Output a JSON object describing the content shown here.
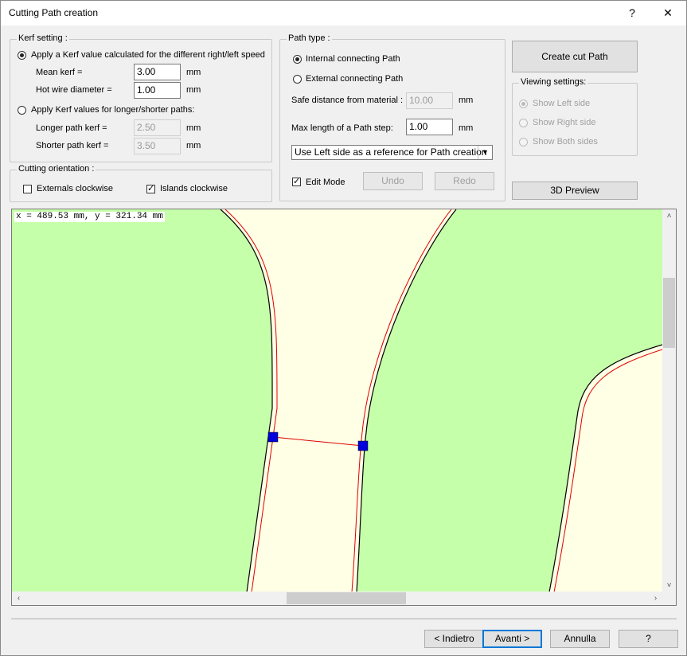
{
  "window": {
    "title": "Cutting Path creation",
    "help_button": "?",
    "close_button": "✕"
  },
  "kerf_setting": {
    "legend": "Kerf setting :",
    "option_calculated": "Apply a Kerf value calculated for the different right/left speed",
    "mean_kerf_label": "Mean kerf =",
    "mean_kerf_value": "3.00",
    "hot_wire_label": "Hot wire diameter =",
    "hot_wire_value": "1.00",
    "option_longer_shorter": "Apply Kerf values for longer/shorter paths:",
    "longer_label": "Longer path kerf =",
    "longer_value": "2.50",
    "shorter_label": "Shorter path kerf =",
    "shorter_value": "3.50",
    "unit": "mm"
  },
  "cutting_orientation": {
    "legend": "Cutting orientation :",
    "externals_label": "Externals clockwise",
    "externals_checked": false,
    "islands_label": "Islands clockwise",
    "islands_checked": true
  },
  "path_type": {
    "legend": "Path type :",
    "internal_label": "Internal connecting Path",
    "external_label": "External connecting  Path",
    "safe_distance_label": "Safe distance from material :",
    "safe_distance_value": "10.00",
    "max_length_label": "Max length of a Path step:",
    "max_length_value": "1.00",
    "unit": "mm",
    "reference_select": "Use Left side as a reference for Path creation",
    "edit_mode_label": "Edit Mode",
    "edit_mode_checked": true,
    "undo_label": "Undo",
    "redo_label": "Redo"
  },
  "actions": {
    "create_cut_path": "Create cut Path",
    "preview_3d": "3D Preview"
  },
  "viewing_settings": {
    "legend": "Viewing settings:",
    "show_left": "Show Left side",
    "show_right": "Show Right side",
    "show_both": "Show Both sides"
  },
  "canvas": {
    "coordinates": "x = 489.53 mm, y = 321.34 mm"
  },
  "footer": {
    "back": "< Indietro",
    "next": "Avanti >",
    "cancel": "Annulla",
    "help": "?"
  },
  "colors": {
    "material": "#c6ffaa",
    "free_area": "#ffffe6",
    "cut_path": "#e00000",
    "handle": "#0000dd"
  }
}
